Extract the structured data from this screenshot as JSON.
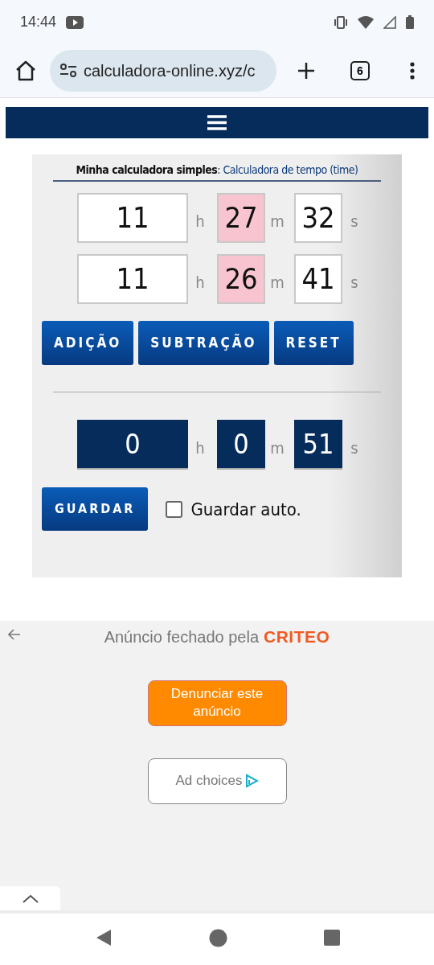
{
  "status_bar": {
    "time": "14:44"
  },
  "browser": {
    "url": "calculadora-online.xyz/c",
    "tab_count": "6"
  },
  "calculator": {
    "title": "**Minha calculadora simples**: Calculadora de tempo (time)",
    "rows": [
      {
        "fields": [
          {
            "value": "11",
            "unit": "h",
            "highlighted": false
          },
          {
            "value": "27",
            "unit": "m",
            "highlighted": true
          },
          {
            "value": "32",
            "unit": "s",
            "highlighted": false
          }
        ]
      },
      {
        "fields": [
          {
            "value": "11",
            "unit": "h",
            "highlighted": false
          },
          {
            "value": "26",
            "unit": "m",
            "highlighted": true
          },
          {
            "value": "41",
            "unit": "s",
            "highlighted": false
          }
        ]
      }
    ],
    "buttons": [
      "ADIÇÃO",
      "SUBTRAÇÃO",
      "RESET"
    ],
    "result": [
      {
        "value": "0",
        "unit": "h"
      },
      {
        "value": "0",
        "unit": "m"
      },
      {
        "value": "51",
        "unit": "s"
      }
    ],
    "save_button": "GUARDAR",
    "auto_save": {
      "label": "Guardar auto.",
      "checked": false
    }
  },
  "ad": {
    "text": "Anúncio fechado pela",
    "brand": "CRITEO",
    "report_button": "Denunciar este anúncio",
    "ad_choices": "Ad choices"
  }
}
